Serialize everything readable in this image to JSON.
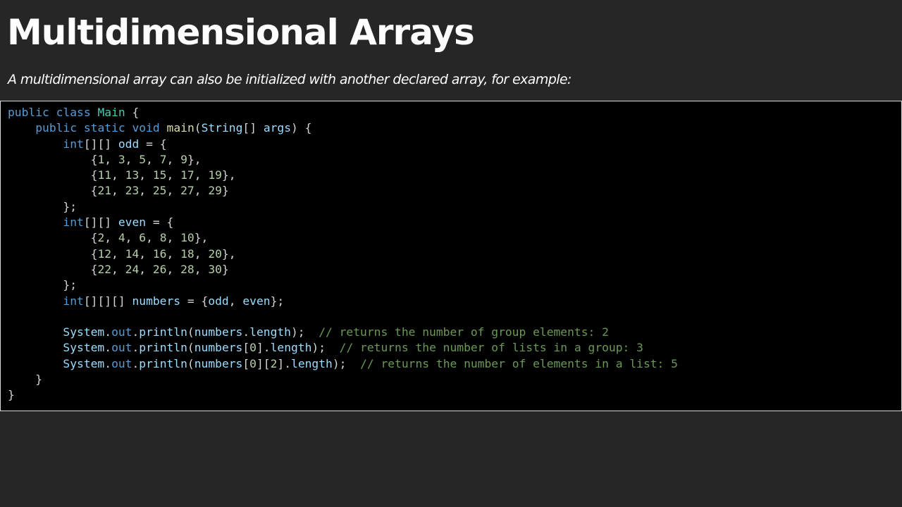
{
  "slide": {
    "title": "Multidimensional Arrays",
    "subtitle": "A multidimensional array can also be initialized with another declared array, for example:"
  },
  "code_block": {
    "language": "java",
    "colors": {
      "background": "#000000",
      "keyword": "#569cd6",
      "type": "#4ec9b0",
      "function": "#dcdcaa",
      "variable": "#9cdcfe",
      "number": "#b5cea8",
      "comment": "#6a9955",
      "punctuation": "#d4d4d4"
    },
    "lines": [
      [
        {
          "t": "kw",
          "v": "public"
        },
        {
          "t": "pun",
          "v": " "
        },
        {
          "t": "kw",
          "v": "class"
        },
        {
          "t": "pun",
          "v": " "
        },
        {
          "t": "type",
          "v": "Main"
        },
        {
          "t": "pun",
          "v": " {"
        }
      ],
      [
        {
          "t": "pun",
          "v": "    "
        },
        {
          "t": "kw",
          "v": "public"
        },
        {
          "t": "pun",
          "v": " "
        },
        {
          "t": "kw",
          "v": "static"
        },
        {
          "t": "pun",
          "v": " "
        },
        {
          "t": "kw",
          "v": "void"
        },
        {
          "t": "pun",
          "v": " "
        },
        {
          "t": "fn",
          "v": "main"
        },
        {
          "t": "pun",
          "v": "("
        },
        {
          "t": "var",
          "v": "String"
        },
        {
          "t": "pun",
          "v": "[] "
        },
        {
          "t": "var",
          "v": "args"
        },
        {
          "t": "pun",
          "v": ") {"
        }
      ],
      [
        {
          "t": "pun",
          "v": "        "
        },
        {
          "t": "kw",
          "v": "int"
        },
        {
          "t": "pun",
          "v": "[][] "
        },
        {
          "t": "var",
          "v": "odd"
        },
        {
          "t": "pun",
          "v": " = {"
        }
      ],
      [
        {
          "t": "pun",
          "v": "            {"
        },
        {
          "t": "num",
          "v": "1"
        },
        {
          "t": "pun",
          "v": ", "
        },
        {
          "t": "num",
          "v": "3"
        },
        {
          "t": "pun",
          "v": ", "
        },
        {
          "t": "num",
          "v": "5"
        },
        {
          "t": "pun",
          "v": ", "
        },
        {
          "t": "num",
          "v": "7"
        },
        {
          "t": "pun",
          "v": ", "
        },
        {
          "t": "num",
          "v": "9"
        },
        {
          "t": "pun",
          "v": "},"
        }
      ],
      [
        {
          "t": "pun",
          "v": "            {"
        },
        {
          "t": "num",
          "v": "11"
        },
        {
          "t": "pun",
          "v": ", "
        },
        {
          "t": "num",
          "v": "13"
        },
        {
          "t": "pun",
          "v": ", "
        },
        {
          "t": "num",
          "v": "15"
        },
        {
          "t": "pun",
          "v": ", "
        },
        {
          "t": "num",
          "v": "17"
        },
        {
          "t": "pun",
          "v": ", "
        },
        {
          "t": "num",
          "v": "19"
        },
        {
          "t": "pun",
          "v": "},"
        }
      ],
      [
        {
          "t": "pun",
          "v": "            {"
        },
        {
          "t": "num",
          "v": "21"
        },
        {
          "t": "pun",
          "v": ", "
        },
        {
          "t": "num",
          "v": "23"
        },
        {
          "t": "pun",
          "v": ", "
        },
        {
          "t": "num",
          "v": "25"
        },
        {
          "t": "pun",
          "v": ", "
        },
        {
          "t": "num",
          "v": "27"
        },
        {
          "t": "pun",
          "v": ", "
        },
        {
          "t": "num",
          "v": "29"
        },
        {
          "t": "pun",
          "v": "}"
        }
      ],
      [
        {
          "t": "pun",
          "v": "        };"
        }
      ],
      [
        {
          "t": "pun",
          "v": "        "
        },
        {
          "t": "kw",
          "v": "int"
        },
        {
          "t": "pun",
          "v": "[][] "
        },
        {
          "t": "var",
          "v": "even"
        },
        {
          "t": "pun",
          "v": " = {"
        }
      ],
      [
        {
          "t": "pun",
          "v": "            {"
        },
        {
          "t": "num",
          "v": "2"
        },
        {
          "t": "pun",
          "v": ", "
        },
        {
          "t": "num",
          "v": "4"
        },
        {
          "t": "pun",
          "v": ", "
        },
        {
          "t": "num",
          "v": "6"
        },
        {
          "t": "pun",
          "v": ", "
        },
        {
          "t": "num",
          "v": "8"
        },
        {
          "t": "pun",
          "v": ", "
        },
        {
          "t": "num",
          "v": "10"
        },
        {
          "t": "pun",
          "v": "},"
        }
      ],
      [
        {
          "t": "pun",
          "v": "            {"
        },
        {
          "t": "num",
          "v": "12"
        },
        {
          "t": "pun",
          "v": ", "
        },
        {
          "t": "num",
          "v": "14"
        },
        {
          "t": "pun",
          "v": ", "
        },
        {
          "t": "num",
          "v": "16"
        },
        {
          "t": "pun",
          "v": ", "
        },
        {
          "t": "num",
          "v": "18"
        },
        {
          "t": "pun",
          "v": ", "
        },
        {
          "t": "num",
          "v": "20"
        },
        {
          "t": "pun",
          "v": "},"
        }
      ],
      [
        {
          "t": "pun",
          "v": "            {"
        },
        {
          "t": "num",
          "v": "22"
        },
        {
          "t": "pun",
          "v": ", "
        },
        {
          "t": "num",
          "v": "24"
        },
        {
          "t": "pun",
          "v": ", "
        },
        {
          "t": "num",
          "v": "26"
        },
        {
          "t": "pun",
          "v": ", "
        },
        {
          "t": "num",
          "v": "28"
        },
        {
          "t": "pun",
          "v": ", "
        },
        {
          "t": "num",
          "v": "30"
        },
        {
          "t": "pun",
          "v": "}"
        }
      ],
      [
        {
          "t": "pun",
          "v": "        };"
        }
      ],
      [
        {
          "t": "pun",
          "v": "        "
        },
        {
          "t": "kw",
          "v": "int"
        },
        {
          "t": "pun",
          "v": "[][][] "
        },
        {
          "t": "var",
          "v": "numbers"
        },
        {
          "t": "pun",
          "v": " = {"
        },
        {
          "t": "var",
          "v": "odd"
        },
        {
          "t": "pun",
          "v": ", "
        },
        {
          "t": "var",
          "v": "even"
        },
        {
          "t": "pun",
          "v": "};"
        }
      ],
      [],
      [
        {
          "t": "pun",
          "v": "        "
        },
        {
          "t": "var",
          "v": "System"
        },
        {
          "t": "pun",
          "v": "."
        },
        {
          "t": "kw",
          "v": "out"
        },
        {
          "t": "pun",
          "v": "."
        },
        {
          "t": "var",
          "v": "println"
        },
        {
          "t": "pun",
          "v": "("
        },
        {
          "t": "var",
          "v": "numbers"
        },
        {
          "t": "pun",
          "v": "."
        },
        {
          "t": "var",
          "v": "length"
        },
        {
          "t": "pun",
          "v": ");  "
        },
        {
          "t": "com",
          "v": "// returns the number of group elements: 2"
        }
      ],
      [
        {
          "t": "pun",
          "v": "        "
        },
        {
          "t": "var",
          "v": "System"
        },
        {
          "t": "pun",
          "v": "."
        },
        {
          "t": "kw",
          "v": "out"
        },
        {
          "t": "pun",
          "v": "."
        },
        {
          "t": "var",
          "v": "println"
        },
        {
          "t": "pun",
          "v": "("
        },
        {
          "t": "var",
          "v": "numbers"
        },
        {
          "t": "pun",
          "v": "["
        },
        {
          "t": "num",
          "v": "0"
        },
        {
          "t": "pun",
          "v": "]."
        },
        {
          "t": "var",
          "v": "length"
        },
        {
          "t": "pun",
          "v": ");  "
        },
        {
          "t": "com",
          "v": "// returns the number of lists in a group: 3"
        }
      ],
      [
        {
          "t": "pun",
          "v": "        "
        },
        {
          "t": "var",
          "v": "System"
        },
        {
          "t": "pun",
          "v": "."
        },
        {
          "t": "kw",
          "v": "out"
        },
        {
          "t": "pun",
          "v": "."
        },
        {
          "t": "var",
          "v": "println"
        },
        {
          "t": "pun",
          "v": "("
        },
        {
          "t": "var",
          "v": "numbers"
        },
        {
          "t": "pun",
          "v": "["
        },
        {
          "t": "num",
          "v": "0"
        },
        {
          "t": "pun",
          "v": "]["
        },
        {
          "t": "num",
          "v": "2"
        },
        {
          "t": "pun",
          "v": "]."
        },
        {
          "t": "var",
          "v": "length"
        },
        {
          "t": "pun",
          "v": ");  "
        },
        {
          "t": "com",
          "v": "// returns the number of elements in a list: 5"
        }
      ],
      [
        {
          "t": "pun",
          "v": "    }"
        }
      ],
      [
        {
          "t": "pun",
          "v": "}"
        }
      ]
    ]
  }
}
